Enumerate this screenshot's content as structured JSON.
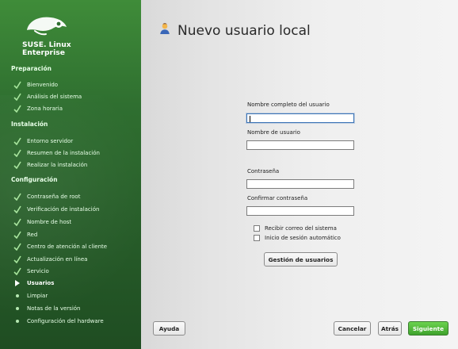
{
  "sidebar": {
    "brand_line1": "SUSE. Linux",
    "brand_line2": "Enterprise",
    "sections": [
      {
        "label": "Preparación"
      },
      {
        "label": "Instalación"
      },
      {
        "label": "Configuración"
      }
    ],
    "items": [
      {
        "label": "Bienvenido",
        "state": "done"
      },
      {
        "label": "Análisis del sistema",
        "state": "done"
      },
      {
        "label": "Zona horaria",
        "state": "done"
      },
      {
        "label": "Entorno servidor",
        "state": "done"
      },
      {
        "label": "Resumen de la instalación",
        "state": "done"
      },
      {
        "label": "Realizar la instalación",
        "state": "done"
      },
      {
        "label": "Contraseña de root",
        "state": "done"
      },
      {
        "label": "Verificación de instalación",
        "state": "done"
      },
      {
        "label": "Nombre de host",
        "state": "done"
      },
      {
        "label": "Red",
        "state": "done"
      },
      {
        "label": "Centro de atención al cliente",
        "state": "done"
      },
      {
        "label": "Actualización en línea",
        "state": "done"
      },
      {
        "label": "Servicio",
        "state": "done"
      },
      {
        "label": "Usuarios",
        "state": "current"
      },
      {
        "label": "Limpiar",
        "state": "pending"
      },
      {
        "label": "Notas de la versión",
        "state": "pending"
      },
      {
        "label": "Configuración del hardware",
        "state": "pending"
      }
    ]
  },
  "main": {
    "title": "Nuevo usuario local",
    "fields": {
      "full_name_label": "Nombre completo del usuario",
      "full_name_value": "",
      "username_label": "Nombre de usuario",
      "username_value": "",
      "password_label": "Contraseña",
      "password_value": "",
      "confirm_password_label": "Confirmar contraseña",
      "confirm_password_value": ""
    },
    "checkboxes": {
      "receive_mail": "Recibir correo del sistema",
      "autologin": "Inicio de sesión automático"
    },
    "buttons": {
      "user_management": "Gestión de usuarios",
      "help": "Ayuda",
      "cancel": "Cancelar",
      "back": "Atrás",
      "next": "Siguiente"
    }
  },
  "colors": {
    "sidebar_green": "#2f6f30",
    "primary_green": "#3fa22c"
  },
  "icons": {
    "done": "check-icon",
    "current": "arrow-right-icon",
    "pending": "bullet-icon",
    "user": "user-icon"
  }
}
